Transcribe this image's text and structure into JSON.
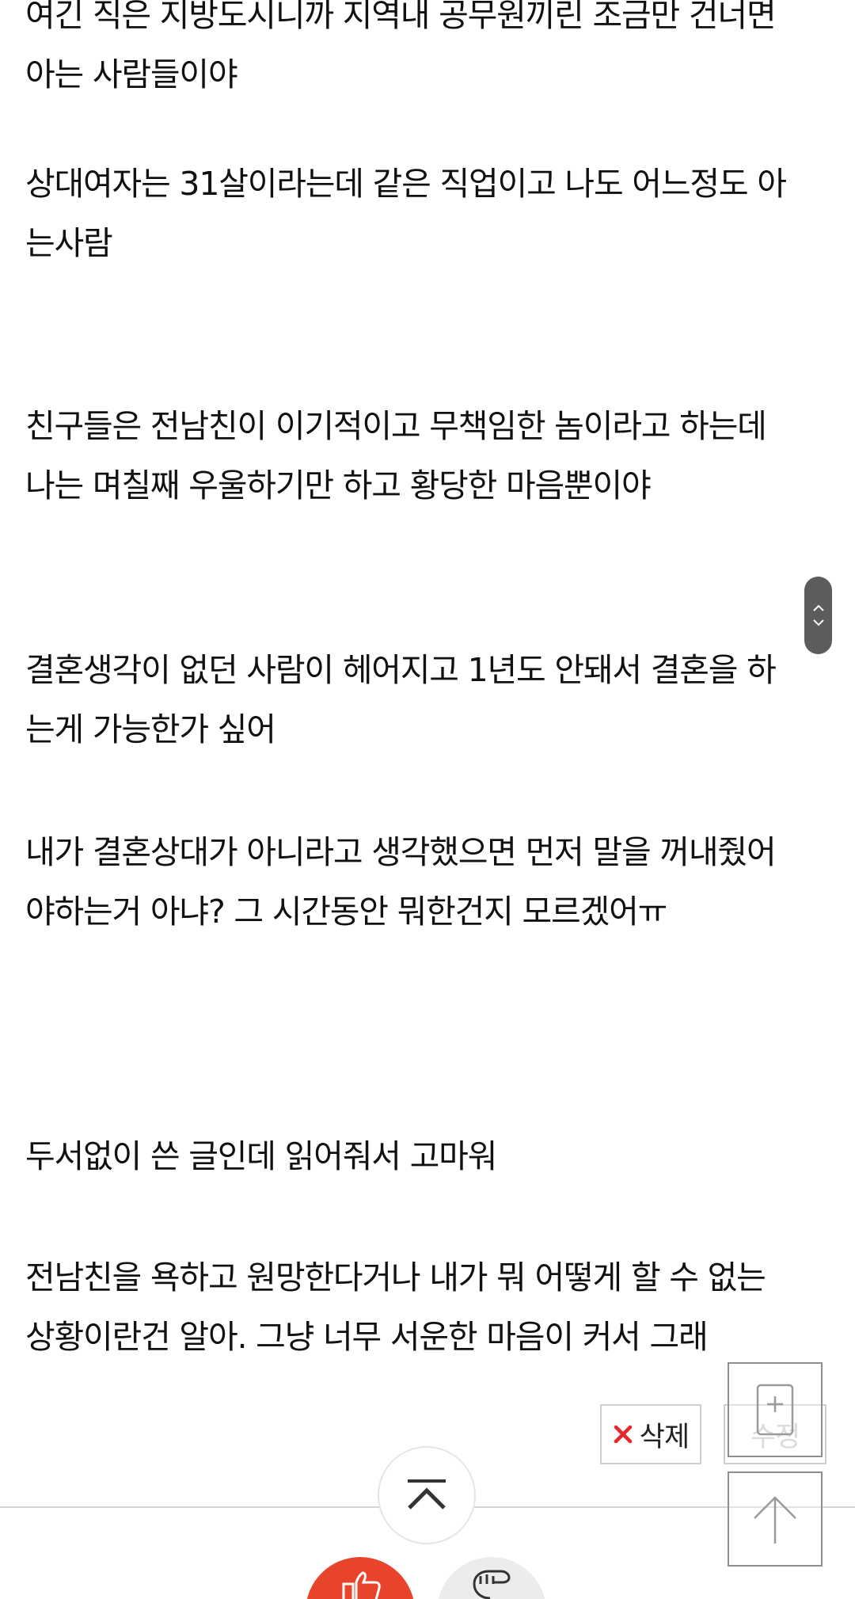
{
  "content": {
    "p0": [
      "여긴 직은 지방도시니까 지역내 공무원끼린 조금만 건너면",
      "아는 사람들이야"
    ],
    "p1": [
      "상대여자는 31살이라는데 같은 직업이고 나도 어느정도 아",
      "는사람"
    ],
    "p2": [
      "친구들은 전남친이 이기적이고 무책임한 놈이라고 하는데",
      "나는 며칠째 우울하기만 하고 황당한 마음뿐이야"
    ],
    "p3": [
      "결혼생각이 없던 사람이 헤어지고 1년도 안돼서 결혼을 하",
      "는게 가능한가 싶어"
    ],
    "p4": [
      "내가 결혼상대가 아니라고 생각했으면 먼저 말을 꺼내줬어",
      "야하는거 아냐? 그 시간동안 뭐한건지 모르겠어ㅠ"
    ],
    "p5": [
      "두서없이 쓴 글인데 읽어줘서 고마워"
    ],
    "p6": [
      "전남친을 욕하고 원망한다거나 내가 뭐 어떻게 할 수 없는",
      "상황이란건 알아. 그냥 너무 서운한 마음이 커서 그래"
    ]
  },
  "actions": {
    "delete_label": "삭제",
    "edit_label": "수정"
  },
  "icons": {
    "delete": "close-icon",
    "add_post": "write-post-icon",
    "scroll_top": "arrow-up-icon",
    "collapse": "chevron-up-icon",
    "like": "thumbs-up-icon",
    "dislike": "thumbs-down-icon"
  },
  "colors": {
    "text": "#111111",
    "delete_x": "#e8262d",
    "like": "#e8442c",
    "dislike": "#ececec",
    "scroll_thumb": "#5c5c5c"
  }
}
